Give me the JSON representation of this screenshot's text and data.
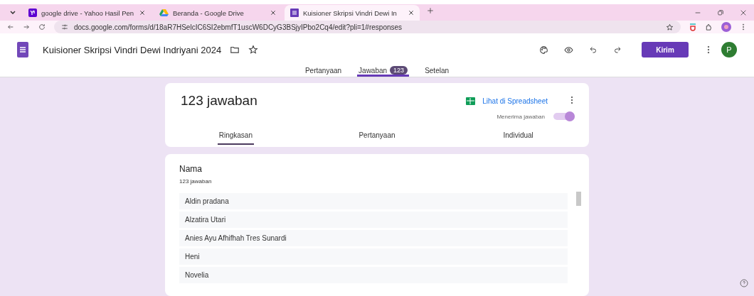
{
  "browser": {
    "tabs": [
      {
        "title": "google drive - Yahoo Hasil Pen",
        "kind": "yahoo",
        "selected": false
      },
      {
        "title": "Beranda - Google Drive",
        "kind": "drive",
        "selected": false
      },
      {
        "title": "Kuisioner Skripsi Vindri Dewi In",
        "kind": "forms",
        "selected": true
      }
    ],
    "url": "docs.google.com/forms/d/18aR7HSelcIC6SI2ebmfT1uscW6DCyG3BSjyIPbo2Cq4/edit?pli=1#responses"
  },
  "header": {
    "title": "Kuisioner Skripsi Vindri Dewi Indriyani 2024",
    "send": "Kirim",
    "avatar": "P"
  },
  "form_tabs": [
    {
      "label": "Pertanyaan",
      "selected": false
    },
    {
      "label": "Jawaban",
      "badge": "123",
      "selected": true
    },
    {
      "label": "Setelan",
      "selected": false
    }
  ],
  "summary": {
    "title": "123 jawaban",
    "sheet_link": "Lihat di Spreadsheet",
    "accepting_label": "Menerima jawaban",
    "accepting": true,
    "tabs": [
      {
        "label": "Ringkasan",
        "selected": true
      },
      {
        "label": "Pertanyaan",
        "selected": false
      },
      {
        "label": "Individual",
        "selected": false
      }
    ]
  },
  "question": {
    "title": "Nama",
    "count": "123 jawaban",
    "answers": [
      "Aldin pradana",
      "Alzatira Utari",
      "Anies Ayu Afhifhah Tres Sunardi",
      "Heni",
      "Novelia"
    ]
  }
}
